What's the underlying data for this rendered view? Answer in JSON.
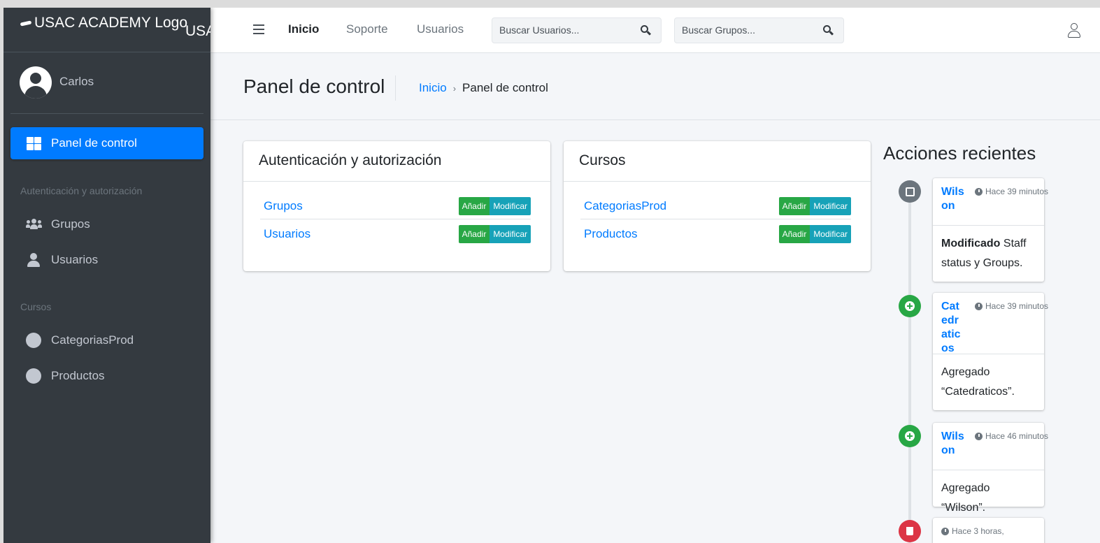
{
  "brand": {
    "logo_alt": "USAC ACADEMY Logo",
    "text": "USAC ACADEMY"
  },
  "user": {
    "name": "Carlos"
  },
  "sidebar": {
    "active_item": "Panel de control",
    "sections": [
      {
        "header": "Autenticación y autorización",
        "items": [
          {
            "label": "Grupos",
            "icon": "users-icon"
          },
          {
            "label": "Usuarios",
            "icon": "user-icon"
          }
        ]
      },
      {
        "header": "Cursos",
        "items": [
          {
            "label": "CategoriasProd",
            "icon": "circle-icon"
          },
          {
            "label": "Productos",
            "icon": "circle-icon"
          }
        ]
      }
    ]
  },
  "navbar": {
    "links": [
      "Inicio",
      "Soporte",
      "Usuarios"
    ],
    "search_users_placeholder": "Buscar Usuarios...",
    "search_groups_placeholder": "Buscar Grupos..."
  },
  "header": {
    "title": "Panel de control",
    "breadcrumb": {
      "home": "Inicio",
      "current": "Panel de control"
    }
  },
  "cards": [
    {
      "title": "Autenticación y autorización",
      "rows": [
        {
          "name": "Grupos",
          "add": "Añadir",
          "change": "Modificar"
        },
        {
          "name": "Usuarios",
          "add": "Añadir",
          "change": "Modificar"
        }
      ]
    },
    {
      "title": "Cursos",
      "rows": [
        {
          "name": "CategoriasProd",
          "add": "Añadir",
          "change": "Modificar"
        },
        {
          "name": "Productos",
          "add": "Añadir",
          "change": "Modificar"
        }
      ]
    }
  ],
  "recent": {
    "title": "Acciones recientes",
    "items": [
      {
        "type": "edit",
        "user": "Wilson",
        "time": "Hace 39 minutos",
        "action_bold": "Modificado",
        "action_text": "Staff status y Groups."
      },
      {
        "type": "add",
        "user": "Catedraticos",
        "time": "Hace 39 minutos",
        "action_bold": "",
        "action_text": "Agregado “Catedraticos”."
      },
      {
        "type": "add",
        "user": "Wilson",
        "time": "Hace 46 minutos",
        "action_bold": "",
        "action_text": "Agregado “Wilson”."
      },
      {
        "type": "delete",
        "user": "",
        "time": "Hace 3 horas,",
        "action_bold": "",
        "action_text": ""
      }
    ]
  },
  "colors": {
    "sidebar_bg": "#343a40",
    "primary": "#007bff",
    "success": "#28a745",
    "info": "#17a2b8",
    "danger": "#dc3545",
    "muted": "#6c757d"
  }
}
